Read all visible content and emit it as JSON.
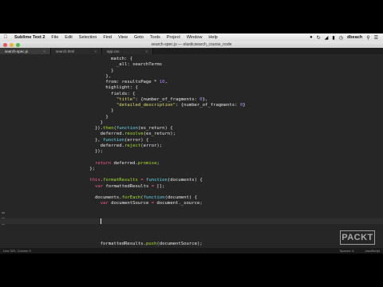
{
  "menubar": {
    "app_name": "Sublime Text 2",
    "items": [
      "File",
      "Edit",
      "Selection",
      "Find",
      "View",
      "Goto",
      "Tools",
      "Project",
      "Window",
      "Help"
    ],
    "user": "dbeach",
    "tray_icons": [
      "notifications-icon",
      "sync-icon",
      "wifi-icon",
      "battery-icon",
      "clock-icon",
      "search-icon",
      "list-icon"
    ]
  },
  "window": {
    "title": "search-spec.js — elasticsearch_course_node"
  },
  "tabs": [
    {
      "label": "search-spec.js",
      "active": true
    },
    {
      "label": "search.html",
      "active": false
    },
    {
      "label": "app.css",
      "active": false
    }
  ],
  "code_lines": [
    [
      {
        "t": "              match: {",
        "c": "plain"
      }
    ],
    [
      {
        "t": "                _all: searchTerms",
        "c": "plain"
      }
    ],
    [
      {
        "t": "              }",
        "c": "plain"
      }
    ],
    [
      {
        "t": "            },",
        "c": "plain"
      }
    ],
    [
      {
        "t": "            from: resultsPage * ",
        "c": "plain"
      },
      {
        "t": "10",
        "c": "num"
      },
      {
        "t": ",",
        "c": "plain"
      }
    ],
    [
      {
        "t": "            highlight: {",
        "c": "plain"
      }
    ],
    [
      {
        "t": "              fields: {",
        "c": "plain"
      }
    ],
    [
      {
        "t": "                ",
        "c": "plain"
      },
      {
        "t": "\"title\"",
        "c": "str"
      },
      {
        "t": ": {number_of_fragments: ",
        "c": "plain"
      },
      {
        "t": "0",
        "c": "num"
      },
      {
        "t": "},",
        "c": "plain"
      }
    ],
    [
      {
        "t": "                ",
        "c": "plain"
      },
      {
        "t": "\"detailed_description\"",
        "c": "str"
      },
      {
        "t": ": {number_of_fragments: ",
        "c": "plain"
      },
      {
        "t": "0",
        "c": "num"
      },
      {
        "t": "}",
        "c": "plain"
      }
    ],
    [
      {
        "t": "              }",
        "c": "plain"
      }
    ],
    [
      {
        "t": "            }",
        "c": "plain"
      }
    ],
    [
      {
        "t": "          }",
        "c": "plain"
      }
    ],
    [
      {
        "t": "        }).",
        "c": "plain"
      },
      {
        "t": "then",
        "c": "prop"
      },
      {
        "t": "(",
        "c": "plain"
      },
      {
        "t": "function",
        "c": "fn"
      },
      {
        "t": "(es_return) {",
        "c": "plain"
      }
    ],
    [
      {
        "t": "          deferred.",
        "c": "plain"
      },
      {
        "t": "resolve",
        "c": "prop"
      },
      {
        "t": "(es_return);",
        "c": "plain"
      }
    ],
    [
      {
        "t": "        }, ",
        "c": "plain"
      },
      {
        "t": "function",
        "c": "fn"
      },
      {
        "t": "(error) {",
        "c": "plain"
      }
    ],
    [
      {
        "t": "          deferred.",
        "c": "plain"
      },
      {
        "t": "reject",
        "c": "prop"
      },
      {
        "t": "(error);",
        "c": "plain"
      }
    ],
    [
      {
        "t": "        });",
        "c": "plain"
      }
    ],
    [
      {
        "t": "",
        "c": "plain"
      }
    ],
    [
      {
        "t": "        ",
        "c": "plain"
      },
      {
        "t": "return",
        "c": "kw"
      },
      {
        "t": " deferred.",
        "c": "plain"
      },
      {
        "t": "promise",
        "c": "prop"
      },
      {
        "t": ";",
        "c": "plain"
      }
    ],
    [
      {
        "t": "      };",
        "c": "plain"
      }
    ],
    [
      {
        "t": "",
        "c": "plain"
      }
    ],
    [
      {
        "t": "      ",
        "c": "plain"
      },
      {
        "t": "this",
        "c": "kw"
      },
      {
        "t": ".",
        "c": "plain"
      },
      {
        "t": "formatResults",
        "c": "prop"
      },
      {
        "t": " = ",
        "c": "kw"
      },
      {
        "t": "function",
        "c": "fn"
      },
      {
        "t": "(documents) {",
        "c": "plain"
      }
    ],
    [
      {
        "t": "        ",
        "c": "plain"
      },
      {
        "t": "var",
        "c": "kw"
      },
      {
        "t": " formattedResults ",
        "c": "plain"
      },
      {
        "t": "=",
        "c": "kw"
      },
      {
        "t": " [];",
        "c": "plain"
      }
    ],
    [
      {
        "t": "",
        "c": "plain"
      }
    ],
    [
      {
        "t": "        documents.",
        "c": "plain"
      },
      {
        "t": "forEach",
        "c": "prop"
      },
      {
        "t": "(",
        "c": "plain"
      },
      {
        "t": "function",
        "c": "fn"
      },
      {
        "t": "(document) {",
        "c": "plain"
      }
    ],
    [
      {
        "t": "          ",
        "c": "plain"
      },
      {
        "t": "var",
        "c": "kw"
      },
      {
        "t": " documentSource ",
        "c": "plain"
      },
      {
        "t": "=",
        "c": "kw"
      },
      {
        "t": " document._source;",
        "c": "plain"
      }
    ],
    [
      {
        "t": "",
        "c": "plain"
      }
    ],
    [
      {
        "t": "",
        "c": "plain"
      }
    ],
    [
      {
        "t": "",
        "c": "plain"
      }
    ],
    [
      {
        "t": "",
        "c": "plain"
      }
    ],
    [
      {
        "t": "",
        "c": "plain"
      }
    ],
    [
      {
        "t": "",
        "c": "plain"
      }
    ],
    [
      {
        "t": "          formattedResults.",
        "c": "plain"
      },
      {
        "t": "push",
        "c": "prop"
      },
      {
        "t": "(documentSource);",
        "c": "plain"
      }
    ]
  ],
  "cursor_line": 28,
  "watermark": "PACKT",
  "statusbar": {
    "left": "Line 323, Column 9",
    "spaces": "Spaces: 4",
    "syntax": "JavaScript"
  }
}
